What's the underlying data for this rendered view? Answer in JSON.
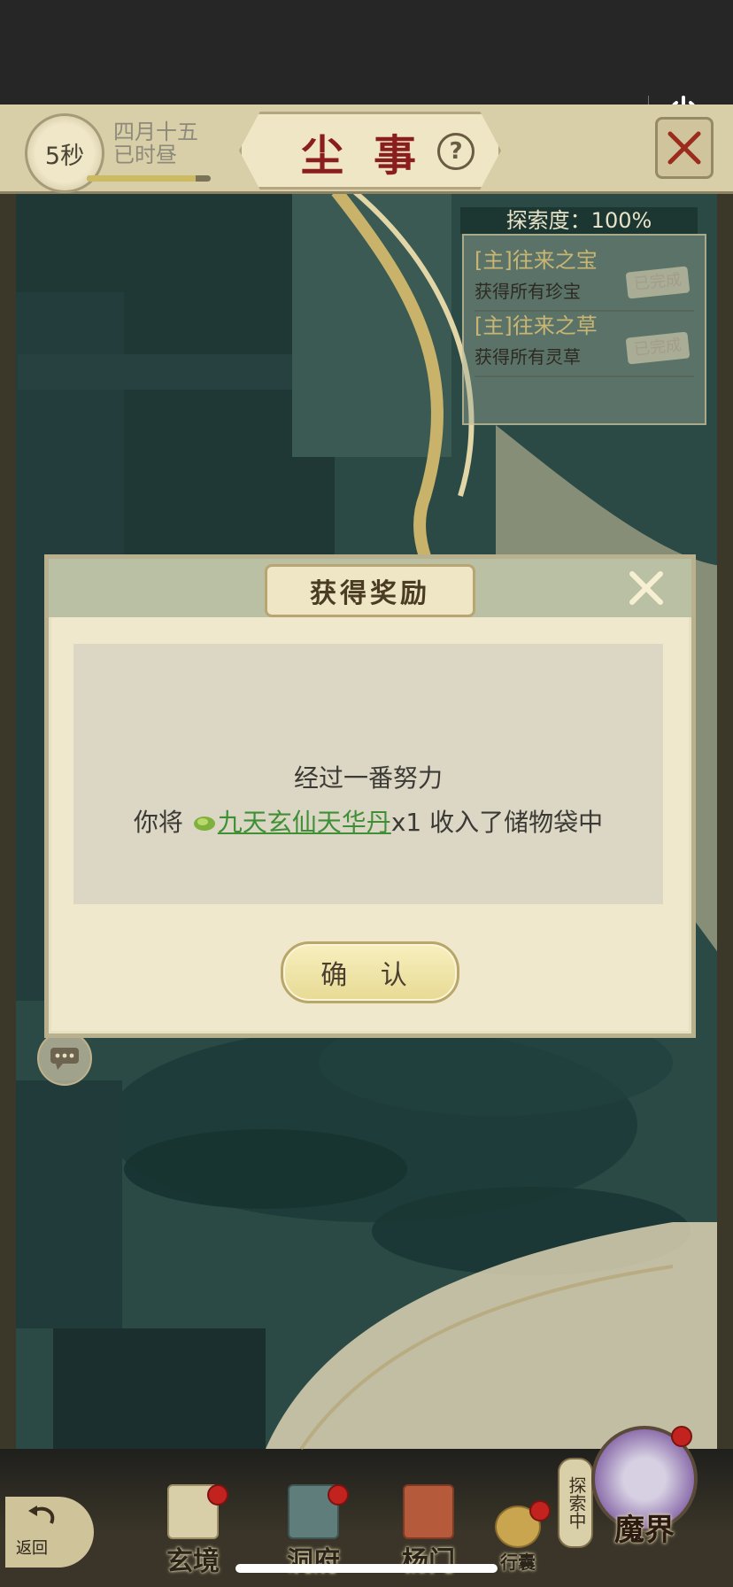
{
  "capsule": {
    "more_icon": "ellipsis-icon",
    "power_icon": "power-icon"
  },
  "header": {
    "timer": "5秒",
    "date_line1": "四月十五",
    "date_line2": "已时昼",
    "time_progress": 0.88,
    "title": "尘事",
    "help_icon": "question-icon"
  },
  "explore": {
    "label": "探索度：100%",
    "quests": [
      {
        "title": "[主]往来之宝",
        "desc": "获得所有珍宝",
        "status": "已完成"
      },
      {
        "title": "[主]往来之草",
        "desc": "获得所有灵草",
        "status": "已完成"
      }
    ]
  },
  "dialog": {
    "title": "获得奖励",
    "line1": "经过一番努力",
    "line2_prefix": "你将",
    "item_name": "九天玄仙天华丹",
    "line2_suffix": "x1 收入了储物袋中",
    "confirm": "确 认"
  },
  "nav": {
    "back": "返回",
    "items": [
      "玄境",
      "洞府",
      "杨门",
      "行囊"
    ],
    "explore_badge": "探索中",
    "realm": "魔界"
  },
  "colors": {
    "accent_green": "#3f8f36",
    "title_red": "#8a1e1e",
    "badge_red": "#c3231f"
  }
}
